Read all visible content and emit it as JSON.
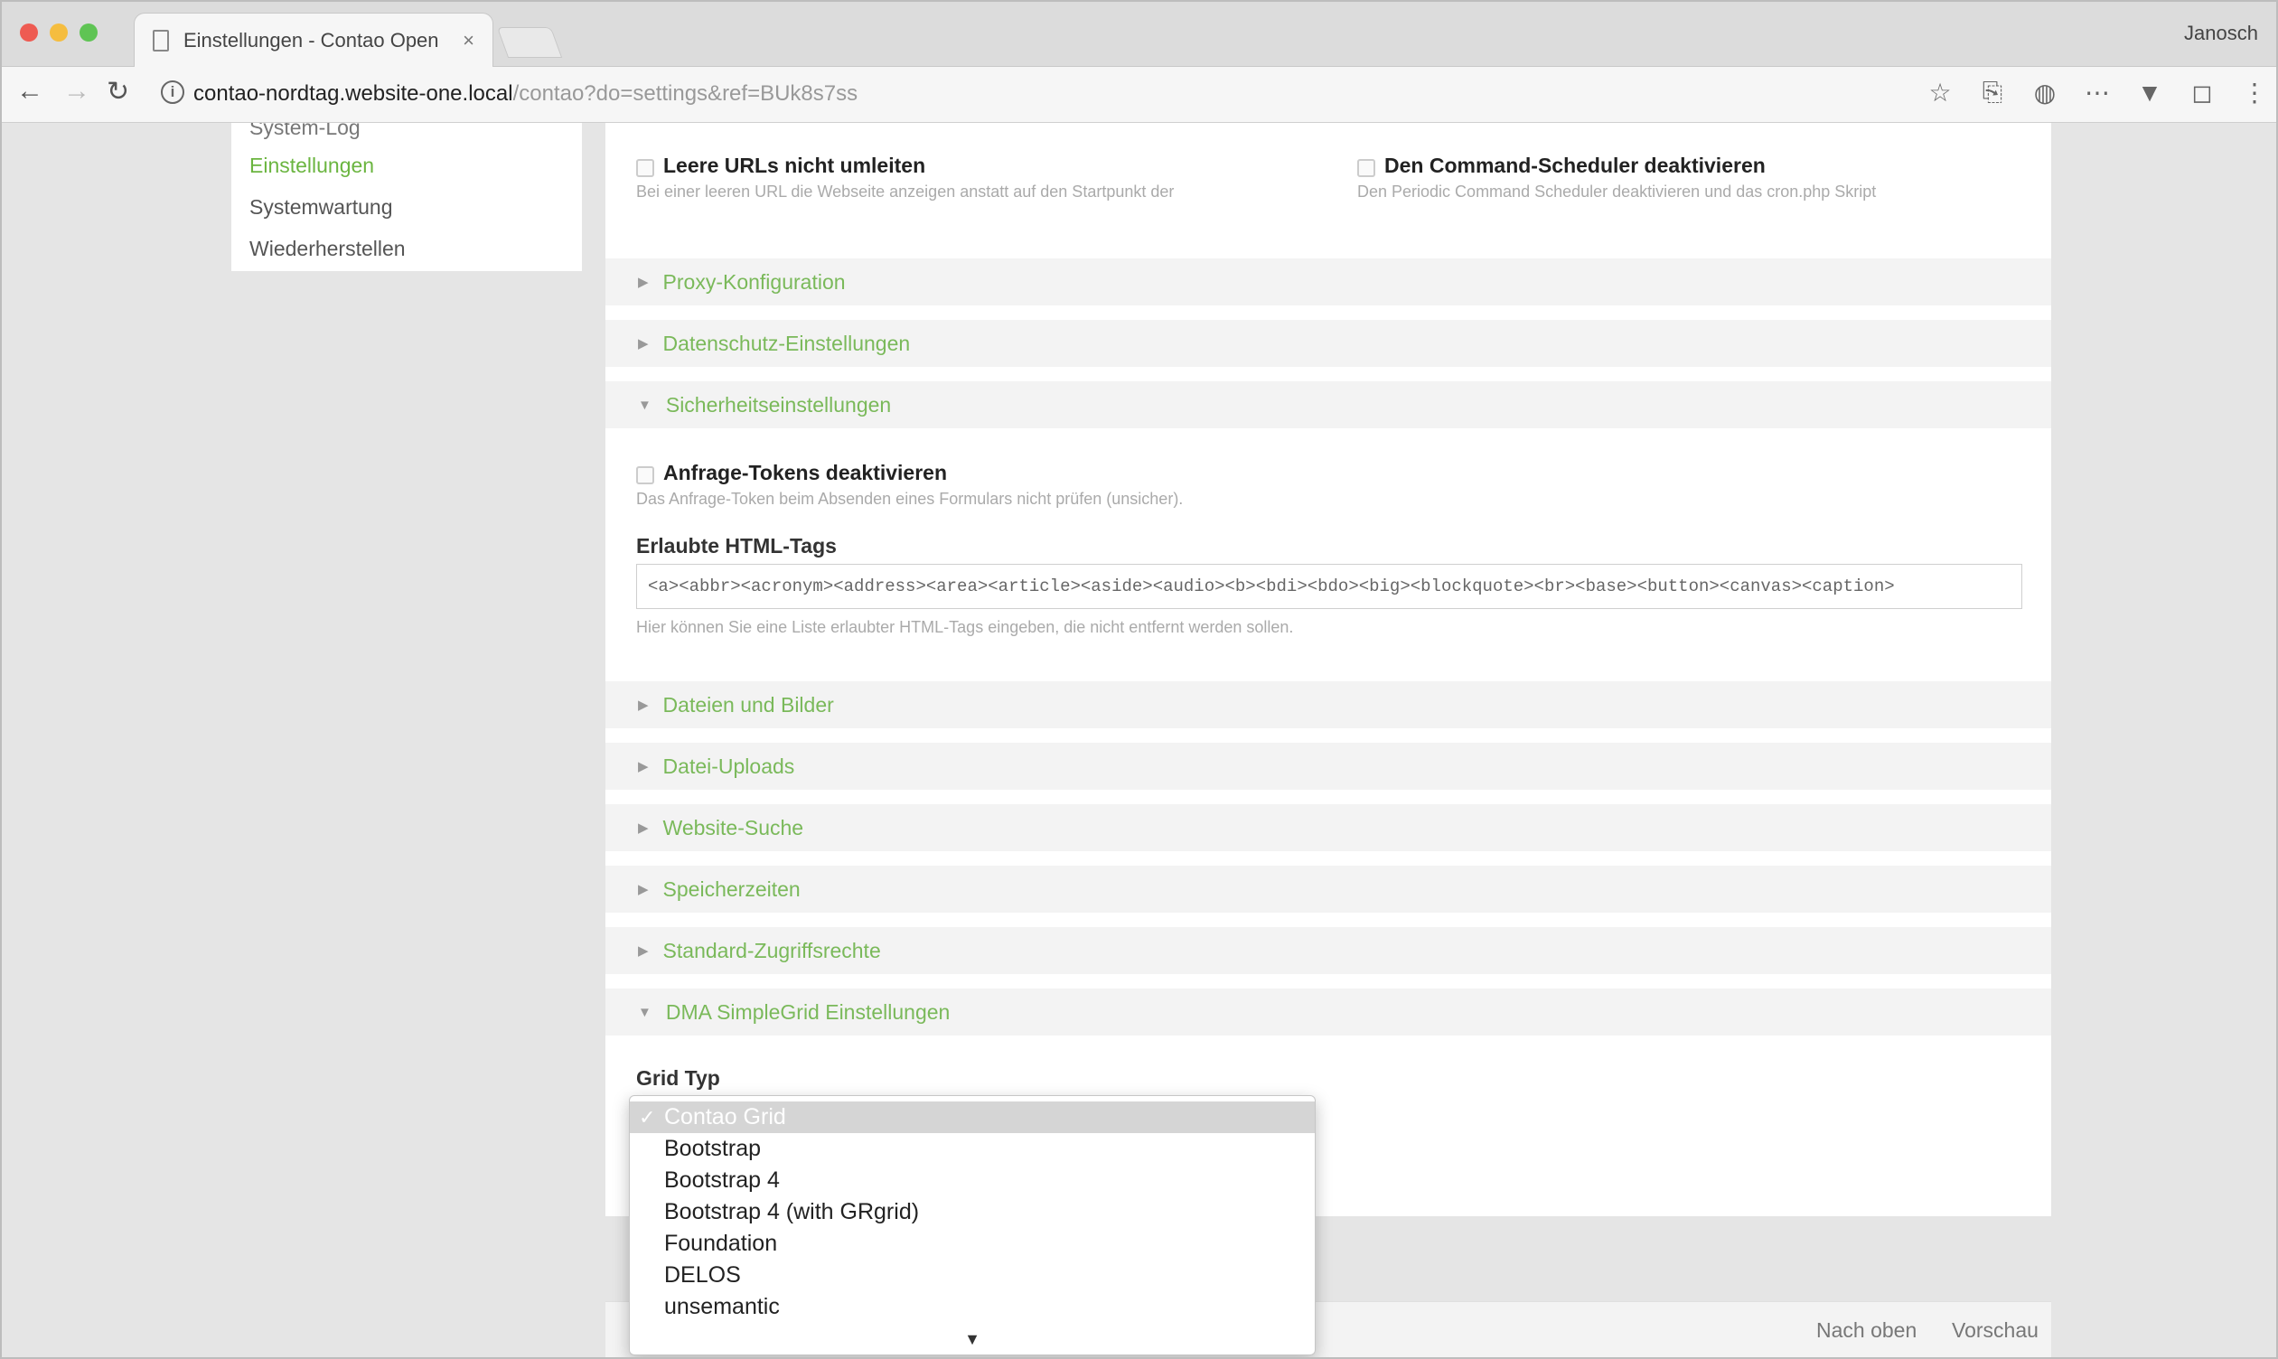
{
  "browser": {
    "tab_title": "Einstellungen - Contao Open",
    "tab_close": "×",
    "user_name": "Janosch",
    "url_host": "contao-nordtag.website-one.local",
    "url_path": "/contao?do=settings&ref=BUk8s7ss",
    "nav_back": "←",
    "nav_forward": "→",
    "nav_reload": "↻"
  },
  "sidebar": {
    "items": [
      {
        "label": "System-Log"
      },
      {
        "label": "Einstellungen"
      },
      {
        "label": "Systemwartung"
      },
      {
        "label": "Wiederherstellen"
      }
    ],
    "active_color": "#6bb540"
  },
  "settings": {
    "top_checks": [
      {
        "label": "Leere URLs nicht umleiten",
        "help": "Bei einer leeren URL die Webseite anzeigen anstatt auf den Startpunkt der"
      },
      {
        "label": "Den Command-Scheduler deaktivieren",
        "help": "Den Periodic Command Scheduler deaktivieren und das cron.php Skript"
      }
    ],
    "legends": [
      "Proxy-Konfiguration",
      "Datenschutz-Einstellungen",
      "Sicherheitseinstellungen",
      "Dateien und Bilder",
      "Datei-Uploads",
      "Website-Suche",
      "Speicherzeiten",
      "Standard-Zugriffsrechte",
      "DMA SimpleGrid Einstellungen"
    ],
    "token_check": {
      "label": "Anfrage-Tokens deaktivieren",
      "help": "Das Anfrage-Token beim Absenden eines Formulars nicht prüfen (unsicher)."
    },
    "html_tags": {
      "label": "Erlaubte HTML-Tags",
      "value": "<a><abbr><acronym><address><area><article><aside><audio><b><bdi><bdo><big><blockquote><br><base><button><canvas><caption>",
      "help": "Hier können Sie eine Liste erlaubter HTML-Tags eingeben, die nicht entfernt werden sollen."
    },
    "grid_type_label": "Grid Typ",
    "legend_color": "#7ab95a"
  },
  "grid_dropdown": {
    "options": [
      {
        "label": "Contao Grid",
        "selected": true
      },
      {
        "label": "Bootstrap"
      },
      {
        "label": "Bootstrap 4"
      },
      {
        "label": "Bootstrap 4 (with GRgrid)"
      },
      {
        "label": "Foundation"
      },
      {
        "label": "DELOS"
      },
      {
        "label": "unsemantic"
      }
    ],
    "selected_tick": "✓",
    "scroll_indicator": "▼"
  },
  "footer": {
    "to_top": "Nach oben",
    "preview": "Vorschau"
  }
}
